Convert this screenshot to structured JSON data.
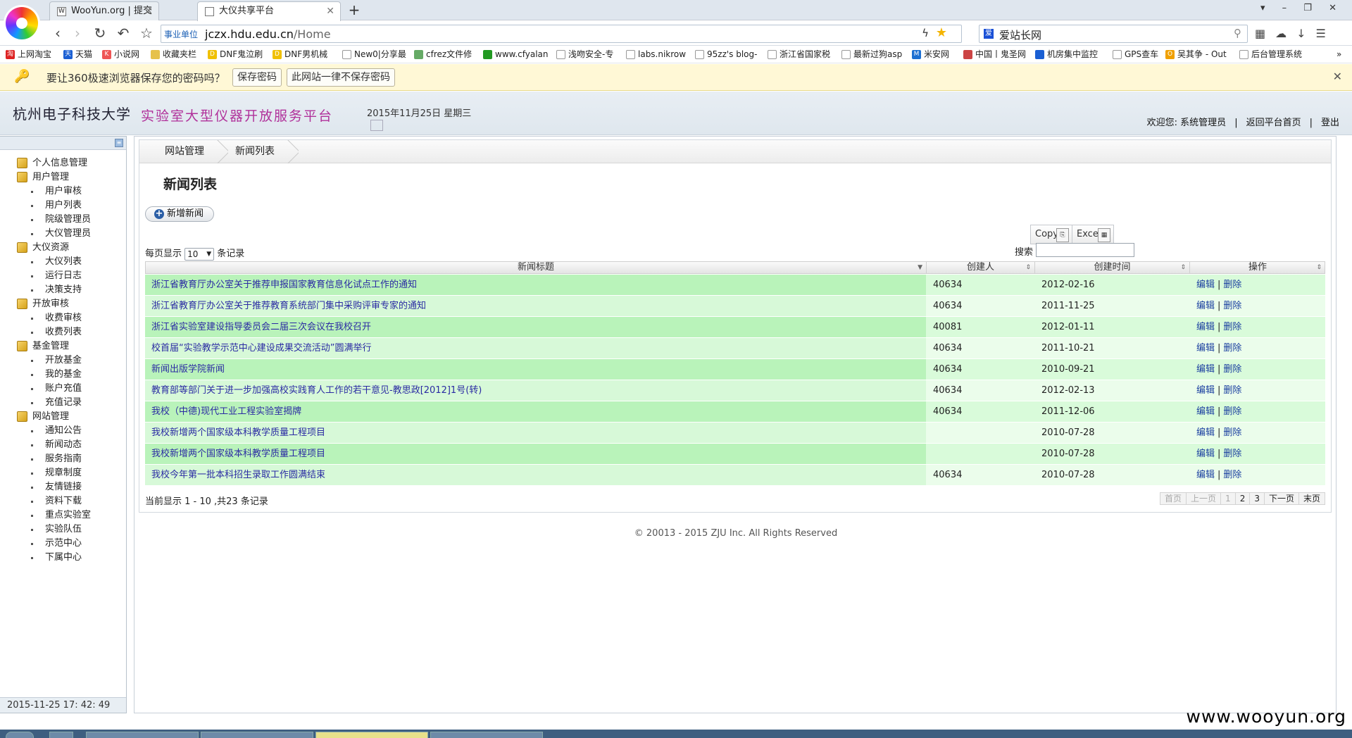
{
  "browser": {
    "tabs": [
      {
        "title": "WooYun.org | 提交漏洞",
        "icon": "wooyun-icon"
      },
      {
        "title": "大仪共享平台",
        "icon": "page-icon"
      }
    ],
    "address": {
      "tag": "事业单位",
      "host": "jczx.hdu.edu.cn",
      "path": "/Home"
    },
    "search_engine_text": "爱站长网",
    "bookmarks": [
      "上网淘宝",
      "天猫",
      "小说网",
      "收藏夹栏",
      "DNF鬼泣刷",
      "DNF男机械",
      "New0|分享最",
      "cfrez文件修",
      "www.cfyalan",
      "浅吻安全-专",
      "labs.nikrow",
      "95zz's blog-",
      "浙江省国家税",
      "最新过狗asp",
      "米安网",
      "中国丨鬼圣网",
      "机房集中监控",
      "GPS查车",
      "吴其争 - Out",
      "后台管理系统"
    ],
    "password_bar": {
      "message": "要让360极速浏览器保存您的密码吗？",
      "save": "保存密码",
      "never": "此网站一律不保存密码"
    }
  },
  "site": {
    "university": "杭州电子科技大学",
    "platform": "实验室大型仪器开放服务平台",
    "date": "2015年11月25日 星期三",
    "welcome": "欢迎您: 系统管理员",
    "back_home": "返回平台首页",
    "logout": "登出",
    "separator": "|"
  },
  "sidebar": {
    "groups": [
      {
        "label": "个人信息管理",
        "items": []
      },
      {
        "label": "用户管理",
        "items": [
          "用户审核",
          "用户列表",
          "院级管理员",
          "大仪管理员"
        ]
      },
      {
        "label": "大仪资源",
        "items": [
          "大仪列表",
          "运行日志",
          "决策支持"
        ]
      },
      {
        "label": "开放审核",
        "items": [
          "收费审核",
          "收费列表"
        ]
      },
      {
        "label": "基金管理",
        "items": [
          "开放基金",
          "我的基金",
          "账户充值",
          "充值记录"
        ]
      },
      {
        "label": "网站管理",
        "items": [
          "通知公告",
          "新闻动态",
          "服务指南",
          "规章制度",
          "友情链接",
          "资料下载",
          "重点实验室",
          "实验队伍",
          "示范中心",
          "下属中心"
        ]
      }
    ],
    "clock": "2015-11-25   17: 42: 49"
  },
  "page": {
    "breadcrumb": [
      "网站管理",
      "新闻列表"
    ],
    "title": "新闻列表",
    "add_button": "新增新闻",
    "export": {
      "copy": "Copy",
      "excel": "Excel"
    },
    "length": {
      "prefix": "每页显示",
      "value": "10",
      "suffix": "条记录"
    },
    "search_label": "搜索",
    "columns": [
      "新闻标题",
      "创建人",
      "创建时间",
      "操作"
    ],
    "actions": {
      "edit": "编辑",
      "sep": "|",
      "delete": "删除"
    },
    "rows": [
      {
        "title": "浙江省教育厅办公室关于推荐申报国家教育信息化试点工作的通知",
        "creator": "40634",
        "date": "2012-02-16"
      },
      {
        "title": "浙江省教育厅办公室关于推荐教育系统部门集中采购评审专家的通知",
        "creator": "40634",
        "date": "2011-11-25"
      },
      {
        "title": "浙江省实验室建设指导委员会二届三次会议在我校召开",
        "creator": "40081",
        "date": "2012-01-11"
      },
      {
        "title": "校首届“实验教学示范中心建设成果交流活动”圆满举行",
        "creator": "40634",
        "date": "2011-10-21"
      },
      {
        "title": "新闻出版学院新闻",
        "creator": "40634",
        "date": "2010-09-21"
      },
      {
        "title": "教育部等部门关于进一步加强高校实践育人工作的若干意见-教思政[2012]1号(转)",
        "creator": "40634",
        "date": "2012-02-13"
      },
      {
        "title": "我校（中德)现代工业工程实验室揭牌",
        "creator": "40634",
        "date": "2011-12-06"
      },
      {
        "title": "我校新增两个国家级本科教学质量工程项目",
        "creator": "",
        "date": "2010-07-28"
      },
      {
        "title": "我校新增两个国家级本科教学质量工程项目",
        "creator": "",
        "date": "2010-07-28"
      },
      {
        "title": "我校今年第一批本科招生录取工作圆满结束",
        "creator": "40634",
        "date": "2010-07-28"
      }
    ],
    "info": "当前显示 1 - 10 ,共23 条记录",
    "pager": [
      "首页",
      "上一页",
      "1",
      "2",
      "3",
      "下一页",
      "末页"
    ],
    "footer": "© 20013 - 2015 ZJU Inc. All Rights Reserved"
  },
  "watermark": "www.wooyun.org",
  "colors": {
    "row_odd": "#b9f3ba",
    "row_even": "#d7f9d8",
    "platform_title": "#b0309a",
    "link": "#2a2aa3"
  }
}
